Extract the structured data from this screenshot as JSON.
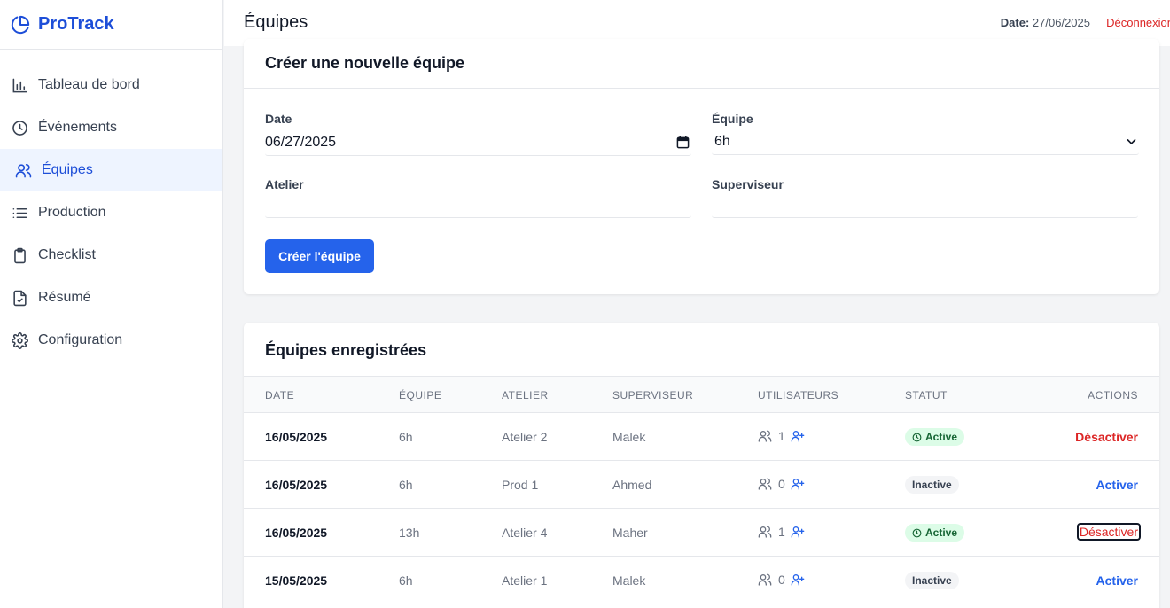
{
  "app": {
    "name": "ProTrack"
  },
  "sidebar": {
    "items": [
      {
        "label": "Tableau de bord",
        "icon": "bar-chart-icon"
      },
      {
        "label": "Événements",
        "icon": "clock-icon"
      },
      {
        "label": "Équipes",
        "icon": "users-icon",
        "active": true
      },
      {
        "label": "Production",
        "icon": "list-icon"
      },
      {
        "label": "Checklist",
        "icon": "clipboard-icon"
      },
      {
        "label": "Résumé",
        "icon": "file-check-icon"
      },
      {
        "label": "Configuration",
        "icon": "gear-icon"
      }
    ]
  },
  "header": {
    "title": "Équipes",
    "date_label": "Date:",
    "date_value": "27/06/2025",
    "logout": "Déconnexion"
  },
  "create_form": {
    "title": "Créer une nouvelle équipe",
    "date_label": "Date",
    "date_value": "06/27/2025",
    "team_label": "Équipe",
    "team_value": "6h",
    "workshop_label": "Atelier",
    "workshop_value": "",
    "supervisor_label": "Superviseur",
    "supervisor_value": "",
    "submit_label": "Créer l'équipe"
  },
  "teams_table": {
    "title": "Équipes enregistrées",
    "columns": [
      "DATE",
      "ÉQUIPE",
      "ATELIER",
      "SUPERVISEUR",
      "UTILISATEURS",
      "STATUT",
      "ACTIONS"
    ],
    "rows": [
      {
        "date": "16/05/2025",
        "team": "6h",
        "workshop": "Atelier 2",
        "supervisor": "Malek",
        "users": "1",
        "status": "Active",
        "action": "Désactiver"
      },
      {
        "date": "16/05/2025",
        "team": "6h",
        "workshop": "Prod 1",
        "supervisor": "Ahmed",
        "users": "0",
        "status": "Inactive",
        "action": "Activer"
      },
      {
        "date": "16/05/2025",
        "team": "13h",
        "workshop": "Atelier 4",
        "supervisor": "Maher",
        "users": "1",
        "status": "Active",
        "action": "Désactiver"
      },
      {
        "date": "15/05/2025",
        "team": "6h",
        "workshop": "Atelier 1",
        "supervisor": "Malek",
        "users": "0",
        "status": "Inactive",
        "action": "Activer"
      }
    ]
  },
  "colors": {
    "accent": "#2563eb",
    "danger": "#dc2626",
    "active_bg": "#dcfce7",
    "active_fg": "#166534"
  }
}
